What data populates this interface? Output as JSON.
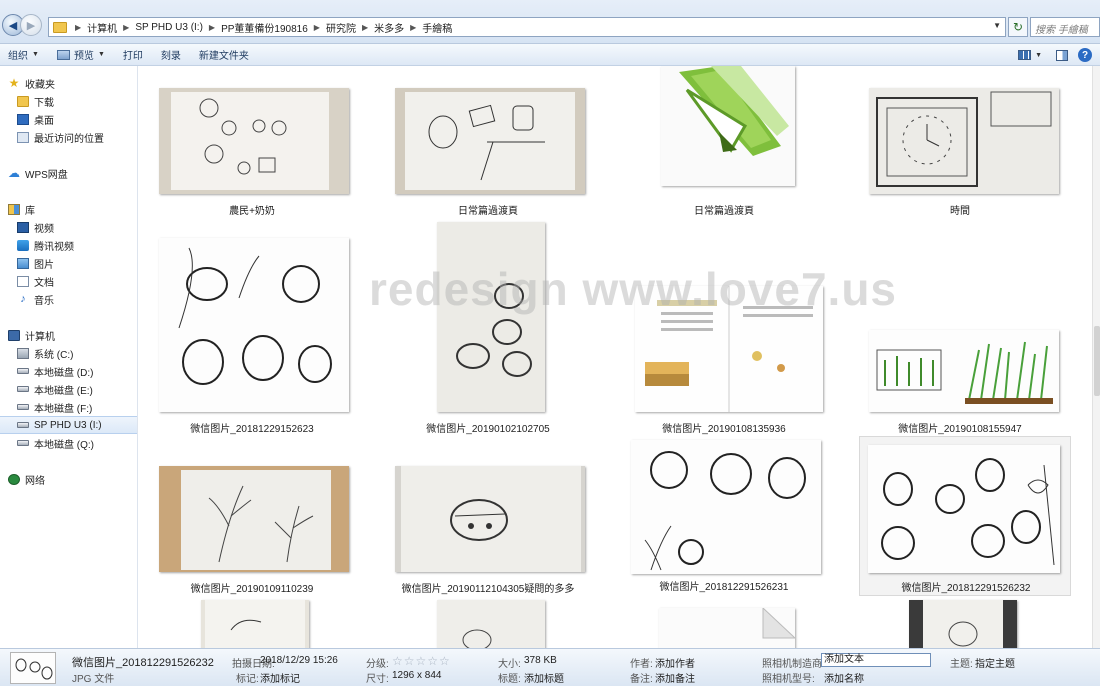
{
  "address": {
    "crumbs": [
      "计算机",
      "SP PHD U3 (I:)",
      "PP董董備份190816",
      "研究院",
      "米多多",
      "手繪稿"
    ],
    "search_placeholder": "搜索 手繪稿"
  },
  "toolbar": {
    "organize": "组织",
    "preview": "预览",
    "print": "打印",
    "burn": "刻录",
    "new_folder": "新建文件夹"
  },
  "sidebar": {
    "favorites": "收藏夹",
    "downloads": "下载",
    "desktop": "桌面",
    "recent": "最近访问的位置",
    "wps": "WPS网盘",
    "library": "库",
    "video": "视频",
    "tencent_video": "腾讯视频",
    "pictures": "图片",
    "documents": "文档",
    "music": "音乐",
    "computer": "计算机",
    "drives": [
      "系统 (C:)",
      "本地磁盘 (D:)",
      "本地磁盘 (E:)",
      "本地磁盘 (F:)",
      "SP PHD U3 (I:)",
      "本地磁盘 (Q:)"
    ],
    "network": "网络"
  },
  "files": [
    {
      "name": "農民+奶奶"
    },
    {
      "name": "日常篇過渡頁"
    },
    {
      "name": "日常篇過渡頁"
    },
    {
      "name": "時間"
    },
    {
      "name": "微信图片_20181229152623"
    },
    {
      "name": "微信图片_20190102102705"
    },
    {
      "name": "微信图片_20190108135936"
    },
    {
      "name": "微信图片_20190108155947"
    },
    {
      "name": "微信图片_20190109110239"
    },
    {
      "name": "微信图片_20190112104305疑問的多多"
    },
    {
      "name": "微信图片_201812291526231"
    },
    {
      "name": "微信图片_201812291526232"
    }
  ],
  "watermark": "redesign www.love7.us",
  "details": {
    "filename": "微信图片_201812291526232",
    "filetype": "JPG 文件",
    "date_taken_label": "拍摄日期:",
    "date_taken": "2018/12/29 15:26",
    "tags_label": "标记:",
    "tags": "添加标记",
    "rating_label": "分级:",
    "rating_stars": "☆☆☆☆☆",
    "dimensions_label": "尺寸:",
    "dimensions": "1296 x 844",
    "size_label": "大小:",
    "size": "378 KB",
    "title_label": "标题:",
    "title": "添加标题",
    "author_label": "作者:",
    "author": "添加作者",
    "comments_label": "备注:",
    "comments": "添加备注",
    "maker_label": "照相机制造商:",
    "maker": "添加文本",
    "model_label": "照相机型号:",
    "model": "添加名称",
    "subject_label": "主题:",
    "subject": "指定主题"
  }
}
